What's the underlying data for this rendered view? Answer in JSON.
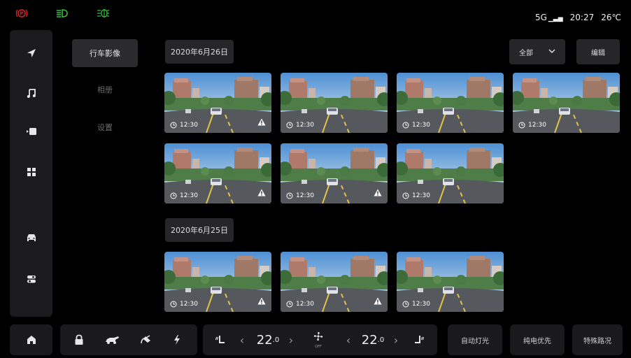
{
  "status": {
    "left_icons": [
      "parking-brake-icon",
      "headlight-icon",
      "fog-light-icon"
    ],
    "network": "5G",
    "time": "20:27",
    "temperature": "26℃"
  },
  "colors": {
    "brake": "#d6212b",
    "headlight": "#30c13a",
    "fog": "#30c13a",
    "panel": "#1b1b1d",
    "chip": "#262628"
  },
  "rail": {
    "icons": [
      "navigation-icon",
      "music-icon",
      "video-icon",
      "apps-icon",
      "car-icon",
      "settings-toggle-icon"
    ]
  },
  "subnav": {
    "items": [
      {
        "label": "行车影像",
        "active": true
      },
      {
        "label": "相册",
        "active": false
      },
      {
        "label": "设置",
        "active": false
      }
    ]
  },
  "toolbar": {
    "filter_label": "全部",
    "edit_label": "编辑"
  },
  "groups": [
    {
      "date": "2020年6月26日",
      "items": [
        {
          "time": "12:30",
          "warning": true
        },
        {
          "time": "12:30",
          "warning": false
        },
        {
          "time": "12:30",
          "warning": false
        },
        {
          "time": "12:30",
          "warning": false
        },
        {
          "time": "12:30",
          "warning": true
        },
        {
          "time": "12:30",
          "warning": true
        },
        {
          "time": "12:30",
          "warning": false
        }
      ]
    },
    {
      "date": "2020年6月25日",
      "items": [
        {
          "time": "12:30",
          "warning": true
        },
        {
          "time": "12:30",
          "warning": true
        },
        {
          "time": "12:30",
          "warning": false
        }
      ]
    }
  ],
  "climate": {
    "left_temp": "22.0",
    "right_temp": "22.0",
    "fan_label": "OFF"
  },
  "bottom_buttons": [
    "自动灯光",
    "纯电优先",
    "特殊路况"
  ]
}
